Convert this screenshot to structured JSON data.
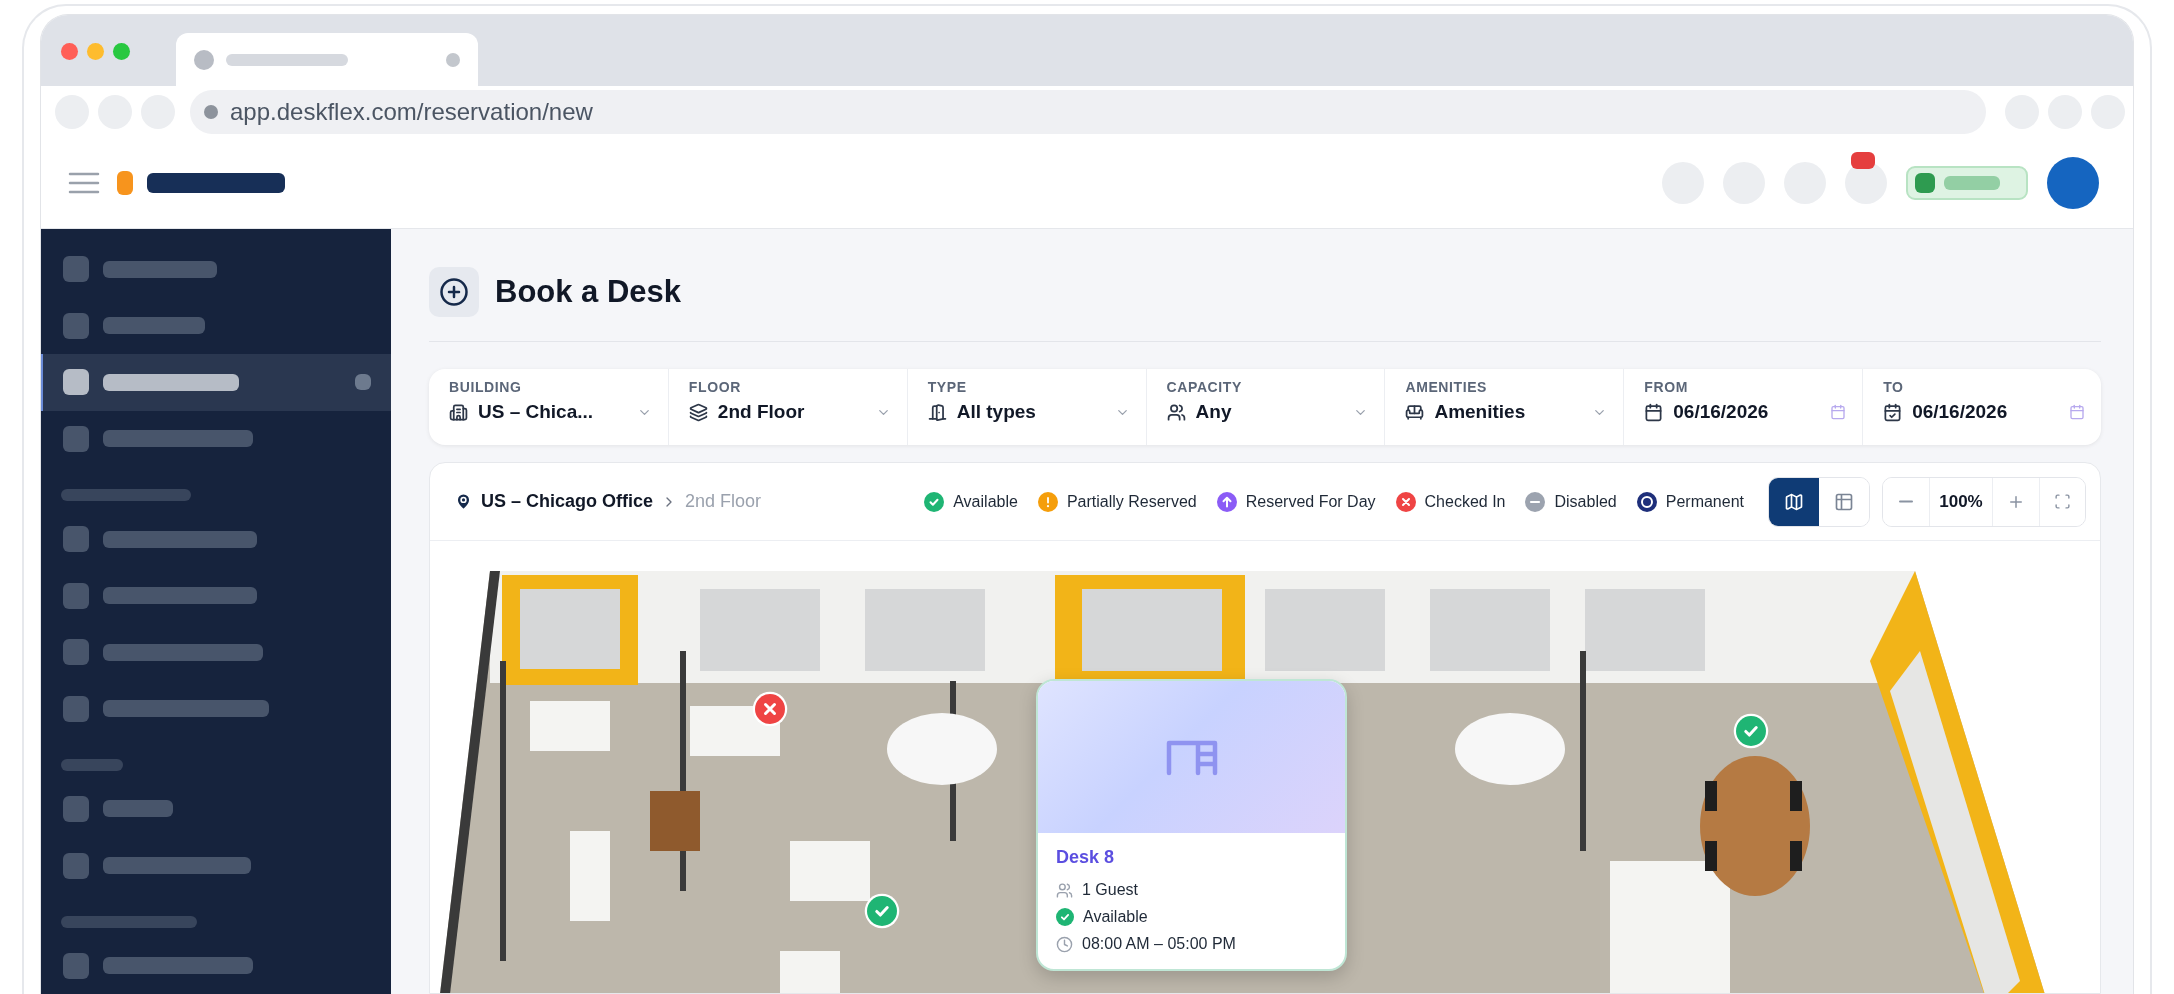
{
  "browser": {
    "url": "app.deskflex.com/reservation/new"
  },
  "sidebar": {
    "items": [
      {
        "kind": "item",
        "selected": false
      },
      {
        "kind": "item",
        "selected": false
      },
      {
        "kind": "item",
        "selected": true
      },
      {
        "kind": "item",
        "selected": false
      },
      {
        "kind": "heading"
      },
      {
        "kind": "item",
        "selected": false
      },
      {
        "kind": "item",
        "selected": false
      },
      {
        "kind": "item",
        "selected": false
      },
      {
        "kind": "item",
        "selected": false
      },
      {
        "kind": "heading"
      },
      {
        "kind": "item",
        "selected": false
      },
      {
        "kind": "item",
        "selected": false
      },
      {
        "kind": "heading"
      },
      {
        "kind": "item",
        "selected": false
      }
    ]
  },
  "page": {
    "title": "Book a Desk"
  },
  "filters": [
    {
      "kind": "select",
      "label": "BUILDING",
      "value": "US – Chica..."
    },
    {
      "kind": "select",
      "label": "FLOOR",
      "value": "2nd Floor"
    },
    {
      "kind": "select",
      "label": "TYPE",
      "value": "All types"
    },
    {
      "kind": "select",
      "label": "CAPACITY",
      "value": "Any"
    },
    {
      "kind": "select",
      "label": "AMENITIES",
      "value": "Amenities"
    },
    {
      "kind": "date",
      "label": "FROM",
      "value": "06/16/2026"
    },
    {
      "kind": "date",
      "label": "TO",
      "value": "06/16/2026"
    }
  ],
  "location": {
    "building": "US – Chicago Office",
    "floor": "2nd Floor"
  },
  "legend": [
    {
      "kind": "check",
      "label": "Available",
      "color": "#1fb574"
    },
    {
      "kind": "alert",
      "label": "Partially Reserved",
      "color": "#f59e0b"
    },
    {
      "kind": "arrow",
      "label": "Reserved For Day",
      "color": "#8b5cf6"
    },
    {
      "kind": "cross",
      "label": "Checked In",
      "color": "#ef4444"
    },
    {
      "kind": "minus",
      "label": "Disabled",
      "color": "#9ca3af"
    },
    {
      "kind": "ring",
      "label": "Permanent",
      "color": "#1e2f7a"
    }
  ],
  "view_toggle": [
    {
      "kind": "map",
      "selected": true
    },
    {
      "kind": "list",
      "selected": false
    }
  ],
  "zoom": {
    "value": "100%"
  },
  "markers": [
    {
      "kind": "cross",
      "color": "#ef4444"
    },
    {
      "kind": "check",
      "color": "#1fb574"
    },
    {
      "kind": "check",
      "color": "#1fb574"
    }
  ],
  "tooltip": {
    "title": "Desk 8",
    "guests": "1 Guest",
    "status": "Available",
    "time": "08:00 AM – 05:00 PM"
  }
}
